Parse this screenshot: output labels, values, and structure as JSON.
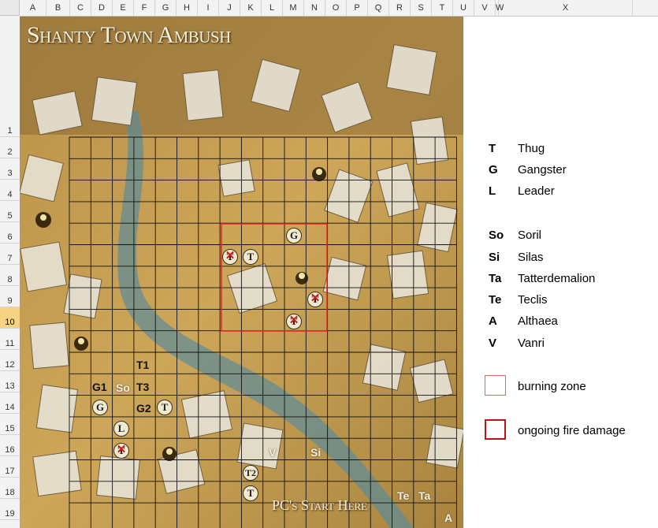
{
  "spreadsheet": {
    "columns": [
      "A",
      "B",
      "C",
      "D",
      "E",
      "F",
      "G",
      "H",
      "I",
      "J",
      "K",
      "L",
      "M",
      "N",
      "O",
      "P",
      "Q",
      "R",
      "S",
      "T",
      "U",
      "V",
      "W",
      "X"
    ],
    "rows": [
      "1",
      "2",
      "3",
      "4",
      "5",
      "6",
      "7",
      "8",
      "9",
      "10",
      "11",
      "12",
      "13",
      "14",
      "15",
      "16",
      "17",
      "18",
      "19"
    ],
    "selected_row": "10"
  },
  "map": {
    "title": "Shanty Town Ambush",
    "start_label": "PC's Start Here",
    "corner_label": "A",
    "labels": {
      "t1": "T1",
      "g1": "G1",
      "so": "So",
      "t3": "T3",
      "g2": "G2",
      "v": "V",
      "si": "Si",
      "t2": "T2",
      "te": "Te",
      "ta": "Ta"
    },
    "tokens": {
      "gangster": "G",
      "thug": "T",
      "leader": "L"
    }
  },
  "legend": {
    "entries": [
      {
        "key": "T",
        "value": "Thug"
      },
      {
        "key": "G",
        "value": "Gangster"
      },
      {
        "key": "L",
        "value": "Leader"
      },
      {
        "key": "So",
        "value": "Soril"
      },
      {
        "key": "Si",
        "value": "Silas"
      },
      {
        "key": "Ta",
        "value": "Tatterdemalion"
      },
      {
        "key": "Te",
        "value": "Teclis"
      },
      {
        "key": "A",
        "value": "Althaea"
      },
      {
        "key": "V",
        "value": "Vanri"
      }
    ],
    "zones": [
      {
        "label": "burning zone",
        "color": "#e0665f"
      },
      {
        "label": "ongoing fire damage",
        "color": "#c0121a"
      }
    ]
  }
}
